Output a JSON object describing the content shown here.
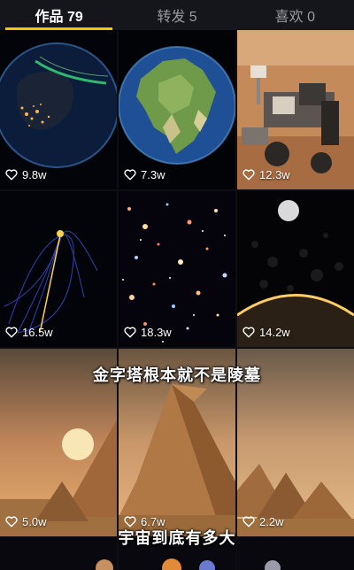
{
  "tabs": [
    {
      "label": "作品 79",
      "active": true
    },
    {
      "label": "转发 5",
      "active": false
    },
    {
      "label": "喜欢 0",
      "active": false
    }
  ],
  "videos": [
    {
      "likes": "9.8w",
      "subject": "earth-at-night"
    },
    {
      "likes": "7.3w",
      "subject": "pangaea-globe"
    },
    {
      "likes": "12.3w",
      "subject": "mars-rover"
    },
    {
      "likes": "16.5w",
      "subject": "orbit-paths"
    },
    {
      "likes": "18.3w",
      "subject": "deep-field-galaxies"
    },
    {
      "likes": "14.2w",
      "subject": "asteroid-impact"
    },
    {
      "likes": "5.0w",
      "subject": "pyramids"
    },
    {
      "likes": "6.7w",
      "subject": "pyramids"
    },
    {
      "likes": "2.2w",
      "subject": "pyramids"
    }
  ],
  "banners": {
    "pyramids_caption": "金字塔根本就不是陵墓",
    "universe_caption": "宇宙到底有多大"
  },
  "icons": {
    "like": "heart-outline-icon"
  },
  "colors": {
    "accent": "#f5c400",
    "background": "#0d0d12"
  }
}
